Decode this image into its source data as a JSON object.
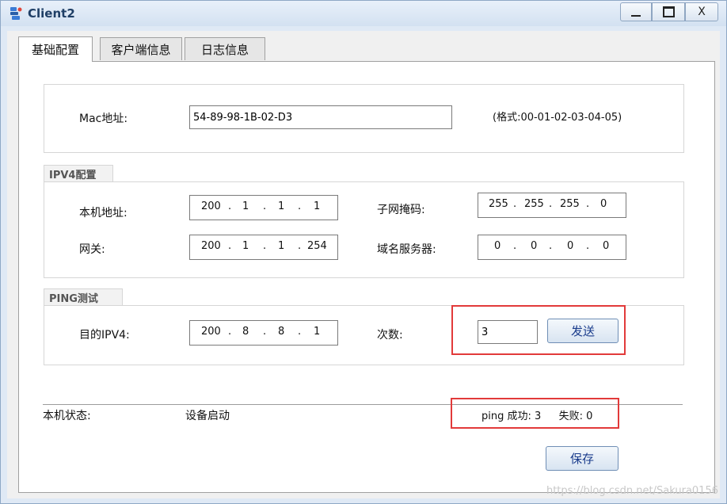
{
  "window": {
    "title": "Client2"
  },
  "titlebar_buttons": {
    "close": "X"
  },
  "tabs": [
    {
      "label": "基础配置",
      "active": true
    },
    {
      "label": "客户端信息",
      "active": false
    },
    {
      "label": "日志信息",
      "active": false
    }
  ],
  "mac": {
    "label": "Mac地址:",
    "value": "54-89-98-1B-02-D3",
    "format_hint": "(格式:00-01-02-03-04-05)"
  },
  "ipv4": {
    "group_label": "IPV4配置",
    "local_label": "本机地址:",
    "local_ip": [
      "200",
      "1",
      "1",
      "1"
    ],
    "mask_label": "子网掩码:",
    "mask": [
      "255",
      "255",
      "255",
      "0"
    ],
    "gateway_label": "网关:",
    "gateway": [
      "200",
      "1",
      "1",
      "254"
    ],
    "dns_label": "域名服务器:",
    "dns": [
      "0",
      "0",
      "0",
      "0"
    ]
  },
  "ping": {
    "group_label": "PING测试",
    "dest_label": "目的IPV4:",
    "dest": [
      "200",
      "8",
      "8",
      "1"
    ],
    "count_label": "次数:",
    "count_value": "3",
    "send_label": "发送"
  },
  "status": {
    "label": "本机状态:",
    "value": "设备启动",
    "success_label": "ping 成功:",
    "success_count": "3",
    "fail_label": "失败:",
    "fail_count": "0"
  },
  "save_label": "保存",
  "watermark": "https://blog.csdn.net/Sakura0156",
  "colors": {
    "highlight_box": "#e23a3a",
    "accent": "#1a3c8c"
  }
}
